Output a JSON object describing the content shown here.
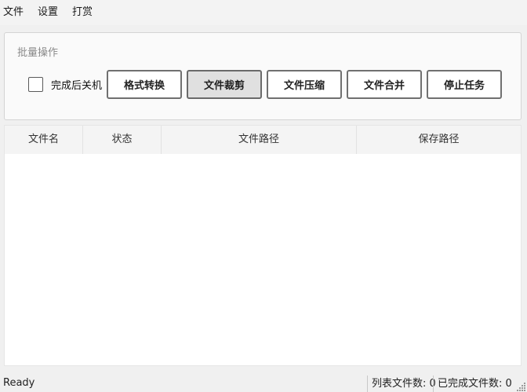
{
  "menubar": {
    "items": [
      "文件",
      "设置",
      "打赏"
    ]
  },
  "batch": {
    "group_title": "批量操作",
    "shutdown_label": "完成后关机",
    "shutdown_checked": false,
    "buttons": {
      "format_convert": "格式转换",
      "file_trim": "文件裁剪",
      "file_compress": "文件压缩",
      "file_merge": "文件合并",
      "stop_task": "停止任务"
    }
  },
  "table": {
    "columns": [
      "文件名",
      "状态",
      "文件路径",
      "保存路径"
    ],
    "rows": []
  },
  "statusbar": {
    "status": "Ready",
    "list_count_label": "列表文件数:",
    "list_count": "0",
    "done_count_label": "已完成文件数:",
    "done_count": "0"
  }
}
